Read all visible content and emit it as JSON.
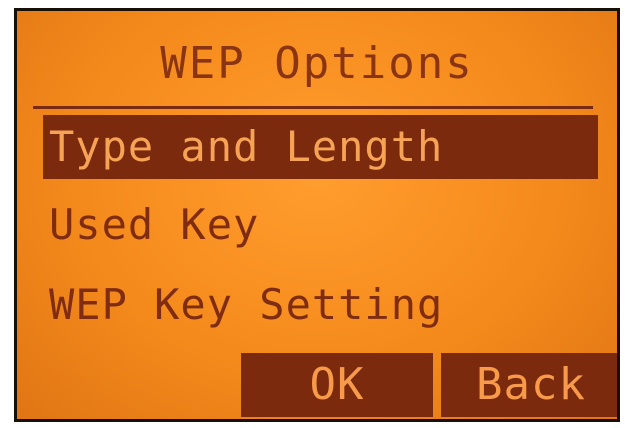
{
  "screen": {
    "title": "WEP Options",
    "menu": [
      {
        "label": "Type and Length",
        "selected": true
      },
      {
        "label": "Used Key",
        "selected": false
      },
      {
        "label": "WEP Key Setting",
        "selected": false
      }
    ],
    "softkeys": {
      "ok": "OK",
      "back": "Back"
    }
  },
  "colors": {
    "lcd_background": "#f58a1c",
    "lcd_text": "#7a2a10",
    "highlight": "#7c2a0e"
  }
}
